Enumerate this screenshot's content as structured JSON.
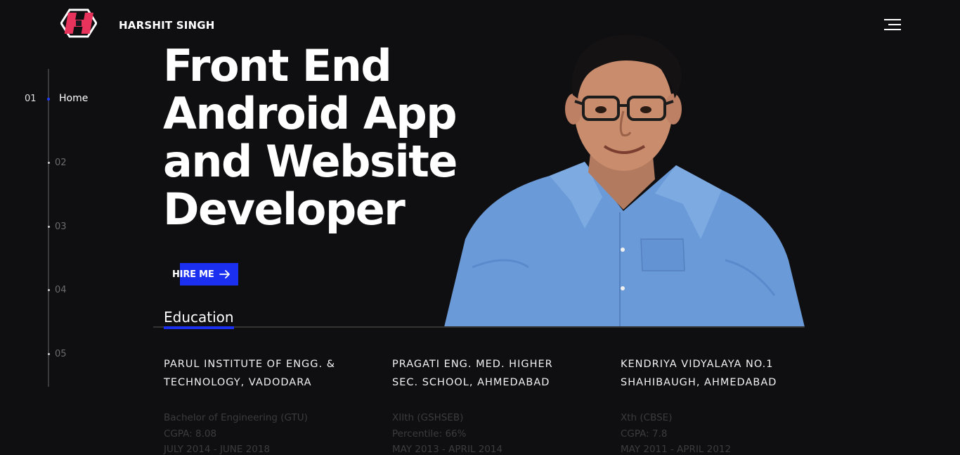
{
  "header": {
    "brand": "HARSHIT SINGH",
    "logo_icon": "hexagon-h-logo-icon",
    "menu_icon": "hamburger-menu-icon"
  },
  "sidenav": {
    "active_number": "01",
    "active_label": "Home",
    "items": [
      "02",
      "03",
      "04",
      "05"
    ]
  },
  "hero": {
    "headline": [
      "Front End",
      "Android App",
      "and Website",
      "Developer"
    ],
    "cta_label": "HIRE ME",
    "cta_icon": "arrow-right-icon"
  },
  "education": {
    "title": "Education",
    "schools": [
      {
        "name_lines": [
          "PARUL INSTITUTE OF ENGG. &",
          "TECHNOLOGY, VADODARA"
        ],
        "details": [
          "Bachelor of Engineering (GTU)",
          "CGPA: 8.08",
          "JULY 2014 - JUNE 2018"
        ]
      },
      {
        "name_lines": [
          "PRAGATI ENG. MED. HIGHER",
          "SEC. SCHOOL, AHMEDABAD"
        ],
        "details": [
          "XIIth (GSHSEB)",
          "Percentile: 66%",
          "MAY 2013 - APRIL 2014"
        ]
      },
      {
        "name_lines": [
          "KENDRIYA VIDYALAYA NO.1",
          "SHAHIBAUGH, AHMEDABAD"
        ],
        "details": [
          "Xth (CBSE)",
          "CGPA: 7.8",
          "MAY 2011 - APRIL 2012"
        ]
      }
    ]
  },
  "colors": {
    "background": "#0f0e10",
    "accent": "#1a2ff0",
    "logo_pink": "#e8345c"
  }
}
